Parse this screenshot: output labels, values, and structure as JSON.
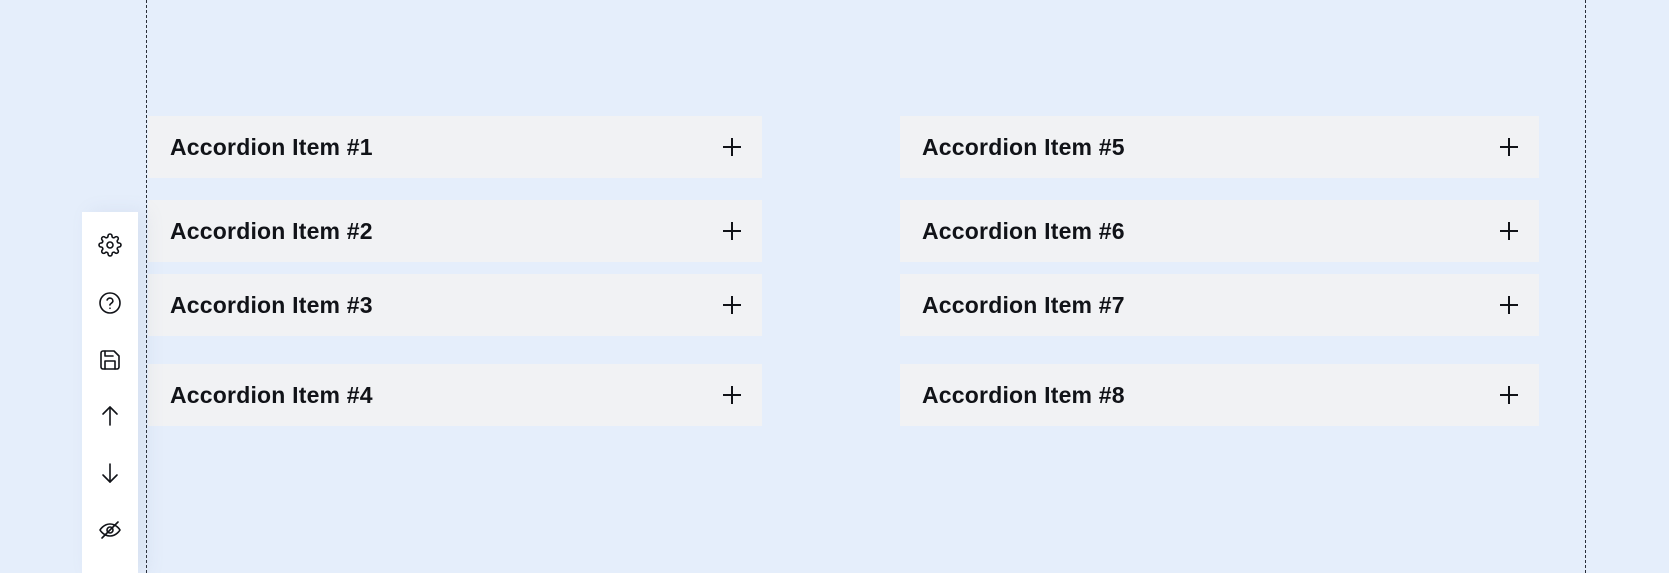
{
  "accordion": {
    "column_a": [
      {
        "title": "Accordion Item #1",
        "icon": "plus-icon"
      },
      {
        "title": "Accordion Item #2",
        "icon": "plus-icon"
      },
      {
        "title": "Accordion Item #3",
        "icon": "plus-icon"
      },
      {
        "title": "Accordion Item #4",
        "icon": "plus-icon"
      }
    ],
    "column_b": [
      {
        "title": "Accordion Item #5",
        "icon": "plus-icon"
      },
      {
        "title": "Accordion Item #6",
        "icon": "plus-icon"
      },
      {
        "title": "Accordion Item #7",
        "icon": "plus-icon"
      },
      {
        "title": "Accordion Item #8",
        "icon": "plus-icon"
      }
    ]
  },
  "toolbar": {
    "buttons": [
      {
        "icon": "gear-icon"
      },
      {
        "icon": "help-circle-icon"
      },
      {
        "icon": "save-icon"
      },
      {
        "icon": "arrow-up-icon"
      },
      {
        "icon": "arrow-down-icon"
      },
      {
        "icon": "eye-off-icon"
      }
    ]
  },
  "colors": {
    "background": "#e5eefb",
    "item_background": "#f1f2f4",
    "text": "#111318",
    "toolbar_background": "#ffffff"
  }
}
